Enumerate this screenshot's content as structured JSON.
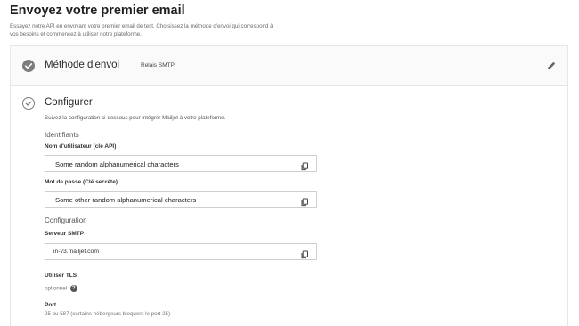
{
  "page": {
    "title": "Envoyez votre premier email",
    "subtitle": "Essayez notre API en envoyant votre premier email de test. Choisissez la méthode d'envoi qui correspond à vos besoins et commencez à utiliser notre plateforme."
  },
  "steps": {
    "method": {
      "title": "Méthode d'envoi",
      "value": "Relais SMTP",
      "icon": "check-circle-filled-icon",
      "edit_icon": "pencil-icon"
    },
    "configure": {
      "title": "Configurer",
      "icon": "check-circle-outline-icon",
      "description": "Suivez la configuration ci-dessous pour intégrer Mailjet à votre plateforme.",
      "identifiants": {
        "heading": "Identifiants",
        "username": {
          "label": "Nom d'utilisateur (clé API)",
          "value": "Some random alphanumerical characters",
          "icon": "copy-icon"
        },
        "password": {
          "label": "Mot de passe (Clé secrète)",
          "value": "Some other random alphanumerical characters",
          "icon": "copy-icon"
        }
      },
      "configuration": {
        "heading": "Configuration",
        "server": {
          "label": "Serveur SMTP",
          "value": "in-v3.mailjet.com",
          "icon": "copy-icon"
        },
        "tls": {
          "label": "Utiliser TLS",
          "help": "optionnel",
          "help_icon": "question-icon"
        },
        "port": {
          "label": "Port",
          "help": "25 ou 587 (certains hébergeurs bloquent le port 25)"
        }
      }
    }
  },
  "colors": {
    "check": "#7c7c7c",
    "border": "#e6e6e6"
  }
}
